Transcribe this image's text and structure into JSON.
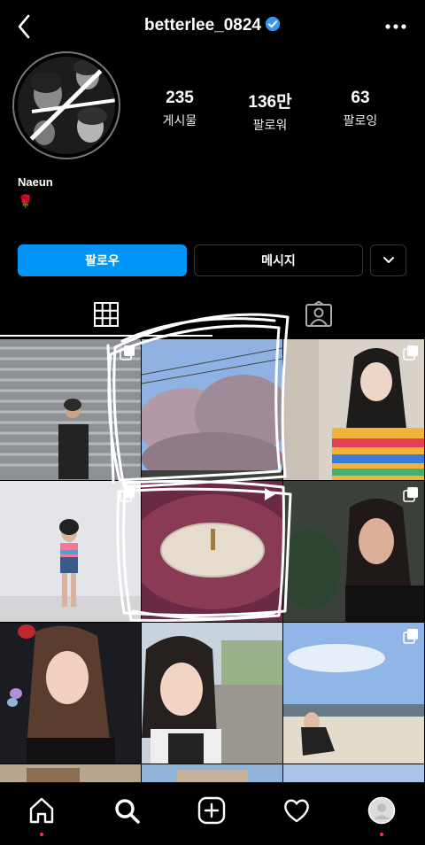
{
  "header": {
    "username": "betterlee_0824"
  },
  "profile": {
    "stats": [
      {
        "value": "235",
        "label": "게시물"
      },
      {
        "value": "136만",
        "label": "팔로워"
      },
      {
        "value": "63",
        "label": "팔로잉"
      }
    ],
    "name": "Naeun",
    "bio_emoji": "🌹"
  },
  "actions": {
    "follow": "팔로우",
    "message": "메시지"
  },
  "colors": {
    "accent": "#0095f6",
    "background": "#000000",
    "notification": "#ff3040"
  },
  "icons": {
    "back": "back-icon",
    "verified": "verified-badge-icon",
    "more": "more-icon",
    "grid_tab": "grid-icon",
    "tagged_tab": "tagged-icon",
    "home": "home-icon",
    "search": "search-icon",
    "add": "add-post-icon",
    "activity": "heart-icon",
    "profile": "profile-avatar-icon"
  },
  "grid": {
    "posts": [
      {
        "kind": "multi-photo"
      },
      {
        "kind": "photo"
      },
      {
        "kind": "multi-photo"
      },
      {
        "kind": "multi-photo"
      },
      {
        "kind": "video"
      },
      {
        "kind": "multi-photo"
      },
      {
        "kind": "photo"
      },
      {
        "kind": "photo"
      },
      {
        "kind": "multi-photo"
      }
    ]
  }
}
